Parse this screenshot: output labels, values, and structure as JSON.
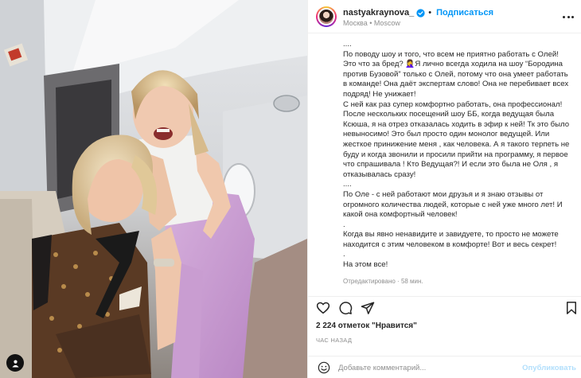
{
  "post": {
    "username": "nastyakraynova_",
    "separator": "•",
    "follow_label": "Подписаться",
    "location": "Москва • Moscow",
    "caption_lines": [
      "....",
      "По поводу шоу и того, что всем не приятно работать с Олей! Это что за бред? 🤦‍♀️Я лично всегда ходила на шоу “Бородина против Бузовой” только с Олей, потому что она умеет работать в команде! Она даёт экспертам слово! Она не перебивает всех подряд! Не унижает!",
      "С ней как раз супер комфортно работать, она профессионал! После нескольких посещений шоу ББ, когда ведущая была Ксюша, я на отрез отказалась ходить в эфир к ней! Тк это было невыносимо! Это был просто один монолог ведущей. Или жесткое принижение меня , как человека. А я такого терпеть не буду и когда звонили и просили прийти на программу, я первое что спрашивала ! Кто Ведущая?! И если это была не Оля , я отказывалась сразу!",
      "....",
      "По Оле - с ней работают мои друзья и я знаю отзывы от огромного количества людей, которые с ней уже много лет! И какой она комфортный человек!",
      ".",
      "Когда вы явно ненавидите и завидуете, то просто не можете находится с этим человеком в комфорте! Вот и весь секрет!",
      ".",
      "На этом все!"
    ],
    "edited_label": "Отредактировано",
    "edited_sep": " · ",
    "edited_time": "58 мин.",
    "likes": "2 224 отметок \"Нравится\"",
    "time_ago": "ЧАС НАЗАД",
    "comment_placeholder": "Добавьте комментарий...",
    "publish_label": "Опубликовать"
  },
  "icons": {
    "like": "heart-icon",
    "comment": "comment-icon",
    "share": "share-icon",
    "save": "bookmark-icon",
    "more": "more-icon",
    "emoji": "emoji-icon",
    "verified": "verified-badge-icon",
    "tag": "user-tag-icon"
  },
  "colors": {
    "accent": "#0095f6",
    "muted": "#8e8e8e",
    "text": "#262626",
    "publish_disabled": "#b2dffc"
  }
}
